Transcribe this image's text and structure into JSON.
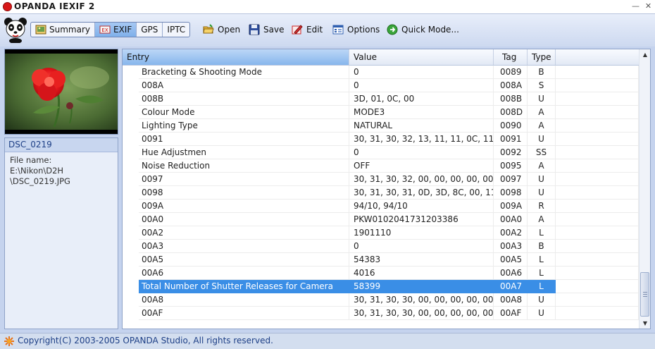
{
  "app": {
    "title": "OPANDA IEXIF 2",
    "window_controls": [
      "minimize-icon",
      "close-icon"
    ]
  },
  "toolbar": {
    "tabs": [
      {
        "label": "Summary",
        "icon": "summary-icon",
        "active": false
      },
      {
        "label": "EXIF",
        "icon": "exif-icon",
        "active": true
      },
      {
        "label": "GPS",
        "icon": "",
        "active": false
      },
      {
        "label": "IPTC",
        "icon": "",
        "active": false
      }
    ],
    "buttons": [
      {
        "label": "Open",
        "icon": "folder-open-icon"
      },
      {
        "label": "Save",
        "icon": "floppy-disk-icon"
      },
      {
        "label": "Edit",
        "icon": "edit-icon"
      },
      {
        "label": "Options",
        "icon": "options-grid-icon"
      },
      {
        "label": "Quick Mode...",
        "icon": "quick-mode-icon"
      }
    ]
  },
  "sidebar": {
    "file_title": "DSC_0219",
    "file_name_label": "File name:",
    "file_path_lines": [
      "E:\\Nikon\\D2H",
      "\\DSC_0219.JPG"
    ]
  },
  "table": {
    "columns": [
      "Entry",
      "Value",
      "Tag",
      "Type"
    ],
    "selected_index": 16,
    "rows": [
      {
        "entry": "Bracketing & Shooting Mode",
        "value": "0",
        "tag": "0089",
        "type": "B"
      },
      {
        "entry": "008A",
        "value": "0",
        "tag": "008A",
        "type": "S"
      },
      {
        "entry": "008B",
        "value": "3D, 01, 0C, 00",
        "tag": "008B",
        "type": "U"
      },
      {
        "entry": "Colour Mode",
        "value": "MODE3",
        "tag": "008D",
        "type": "A"
      },
      {
        "entry": "Lighting Type",
        "value": "NATURAL",
        "tag": "0090",
        "type": "A"
      },
      {
        "entry": "0091",
        "value": "30, 31, 30, 32, 13, 11, 11, 0C, 11, ...",
        "tag": "0091",
        "type": "U"
      },
      {
        "entry": "Hue Adjustmen",
        "value": "0",
        "tag": "0092",
        "type": "SS"
      },
      {
        "entry": "Noise Reduction",
        "value": "OFF",
        "tag": "0095",
        "type": "A"
      },
      {
        "entry": "0097",
        "value": "30, 31, 30, 32, 00, 00, 00, 00, 00, ...",
        "tag": "0097",
        "type": "U"
      },
      {
        "entry": "0098",
        "value": "30, 31, 30, 31, 0D, 3D, 8C, 00, 11,...",
        "tag": "0098",
        "type": "U"
      },
      {
        "entry": "009A",
        "value": "94/10, 94/10",
        "tag": "009A",
        "type": "R"
      },
      {
        "entry": "00A0",
        "value": " PKW0102041731203386",
        "tag": "00A0",
        "type": "A"
      },
      {
        "entry": "00A2",
        "value": "1901110",
        "tag": "00A2",
        "type": "L"
      },
      {
        "entry": "00A3",
        "value": "0",
        "tag": "00A3",
        "type": "B"
      },
      {
        "entry": "00A5",
        "value": "54383",
        "tag": "00A5",
        "type": "L"
      },
      {
        "entry": "00A6",
        "value": "4016",
        "tag": "00A6",
        "type": "L"
      },
      {
        "entry": "Total Number of Shutter Releases for Camera",
        "value": "58399",
        "tag": "00A7",
        "type": "L"
      },
      {
        "entry": "00A8",
        "value": "30, 31, 30, 30, 00, 00, 00, 00, 00, ...",
        "tag": "00A8",
        "type": "U"
      },
      {
        "entry": "00AF",
        "value": "30, 31, 30, 30, 00, 00, 00, 00, 00, ...",
        "tag": "00AF",
        "type": "U"
      }
    ]
  },
  "scrollbar": {
    "position_fraction": 0.85
  },
  "status_bar": {
    "text": "Copyright(C) 2003-2005 OPANDA Studio, All rights reserved.",
    "icon": "opanda-sun-icon"
  },
  "colors": {
    "selection": "#3a8ee6",
    "active_tab": "#8ab8ee",
    "title_logo": "#d81818"
  }
}
